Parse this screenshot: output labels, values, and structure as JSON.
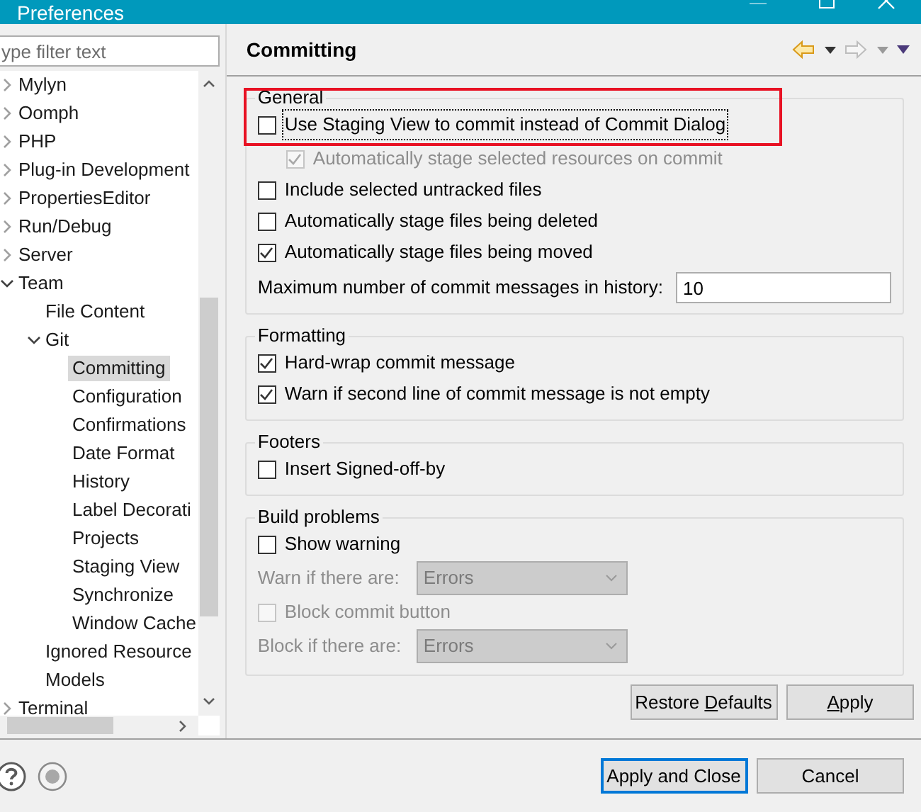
{
  "window": {
    "title": "Preferences"
  },
  "filter": {
    "placeholder": "ype filter text"
  },
  "tree": [
    {
      "label": "Mylyn",
      "expanded": false,
      "selected": false
    },
    {
      "label": "Oomph",
      "expanded": false,
      "selected": false
    },
    {
      "label": "PHP",
      "expanded": false,
      "selected": false
    },
    {
      "label": "Plug-in Development",
      "expanded": false,
      "selected": false
    },
    {
      "label": "PropertiesEditor",
      "expanded": false,
      "selected": false
    },
    {
      "label": "Run/Debug",
      "expanded": false,
      "selected": false
    },
    {
      "label": "Server",
      "expanded": false,
      "selected": false
    },
    {
      "label": "Team",
      "expanded": true,
      "selected": false,
      "children": [
        {
          "label": "File Content",
          "selected": false
        },
        {
          "label": "Git",
          "expanded": true,
          "selected": false,
          "children": [
            {
              "label": "Committing",
              "selected": true
            },
            {
              "label": "Configuration",
              "selected": false
            },
            {
              "label": "Confirmations",
              "selected": false
            },
            {
              "label": "Date Format",
              "selected": false
            },
            {
              "label": "History",
              "selected": false
            },
            {
              "label": "Label Decorati",
              "selected": false
            },
            {
              "label": "Projects",
              "selected": false
            },
            {
              "label": "Staging View",
              "selected": false
            },
            {
              "label": "Synchronize",
              "selected": false
            },
            {
              "label": "Window Cache",
              "selected": false
            }
          ]
        },
        {
          "label": "Ignored Resource",
          "selected": false
        },
        {
          "label": "Models",
          "selected": false
        }
      ]
    },
    {
      "label": "Terminal",
      "expanded": false,
      "selected": false
    }
  ],
  "page": {
    "title": "Committing"
  },
  "groups": [
    {
      "title": "General",
      "highlighted": true,
      "options": [
        {
          "kind": "checkbox",
          "label": "Use Staging View to commit instead of Commit Dialog",
          "checked": false,
          "disabled": false,
          "focused": true,
          "children": [
            {
              "kind": "checkbox",
              "label": "Automatically stage selected resources on commit",
              "checked": true,
              "disabled": true
            }
          ]
        },
        {
          "kind": "checkbox",
          "label": "Include selected untracked files",
          "checked": false,
          "disabled": false
        },
        {
          "kind": "checkbox",
          "label": "Automatically stage files being deleted",
          "checked": false,
          "disabled": false
        },
        {
          "kind": "checkbox",
          "label": "Automatically stage files being moved",
          "checked": true,
          "disabled": false
        },
        {
          "kind": "number",
          "label": "Maximum number of commit messages in history:",
          "value": "10"
        }
      ]
    },
    {
      "title": "Formatting",
      "options": [
        {
          "kind": "checkbox",
          "label": "Hard-wrap commit message",
          "checked": true,
          "disabled": false
        },
        {
          "kind": "checkbox",
          "label": "Warn if second line of commit message is not empty",
          "checked": true,
          "disabled": false
        }
      ]
    },
    {
      "title": "Footers",
      "options": [
        {
          "kind": "checkbox",
          "label": "Insert Signed-off-by",
          "checked": false,
          "disabled": false
        }
      ]
    },
    {
      "title": "Build problems",
      "options": [
        {
          "kind": "checkbox",
          "label": "Show warning",
          "checked": false,
          "disabled": false
        },
        {
          "kind": "select",
          "label": "Warn if there are:",
          "value": "Errors",
          "disabled": true
        },
        {
          "kind": "checkbox",
          "label": "Block commit button",
          "checked": false,
          "disabled": true
        },
        {
          "kind": "select",
          "label": "Block if there are:",
          "value": "Errors",
          "disabled": true
        }
      ]
    }
  ],
  "page_buttons": [
    {
      "prefix": "Restore ",
      "key": "D",
      "suffix": "efaults"
    },
    {
      "key": "A",
      "suffix": "pply"
    }
  ],
  "dialog_buttons": [
    {
      "label": "Apply and Close",
      "default": true
    },
    {
      "label": "Cancel",
      "default": false
    }
  ]
}
